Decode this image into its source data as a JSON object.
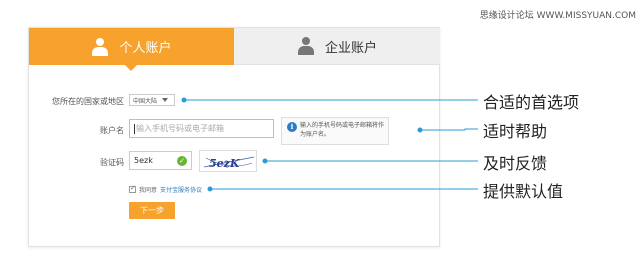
{
  "watermark": "思缘设计论坛 WWW.MISSYUAN.COM",
  "tabs": {
    "personal": "个人账户",
    "enterprise": "企业账户"
  },
  "form": {
    "country_label": "您所在的国家或地区",
    "country_value": "中国大陆",
    "account_label": "账户名",
    "account_placeholder": "输入手机号码或电子邮箱",
    "tip_text": "输入的手机号码或电子邮箱将作为账户名。",
    "captcha_label": "验证码",
    "captcha_value": "5ezk",
    "captcha_image_text": "5ezK",
    "agree_prefix": "我同意",
    "agree_link": "支付宝服务协议",
    "next_button": "下一步"
  },
  "callouts": {
    "default_selection": "合适的首选项",
    "timely_help": "适时帮助",
    "timely_feedback": "及时反馈",
    "default_value": "提供默认值"
  },
  "colors": {
    "accent_orange": "#f6a22d",
    "callout_blue": "#2d9bd6",
    "ok_green": "#67b533",
    "info_blue": "#2d7bc4"
  }
}
